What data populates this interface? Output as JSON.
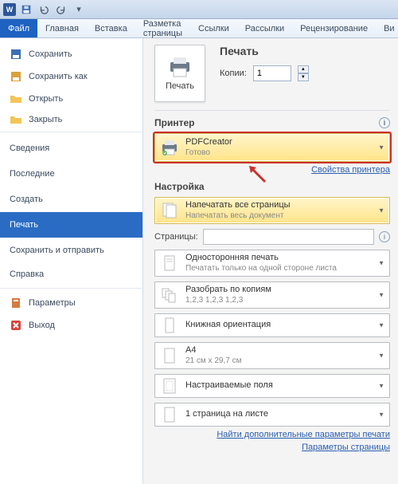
{
  "qat": {
    "app": "W"
  },
  "ribbon": {
    "tabs": [
      "Файл",
      "Главная",
      "Вставка",
      "Разметка страницы",
      "Ссылки",
      "Рассылки",
      "Рецензирование",
      "Ви"
    ],
    "active": 0
  },
  "sidebar": {
    "save": "Сохранить",
    "save_as": "Сохранить как",
    "open": "Открыть",
    "close": "Закрыть",
    "info": "Сведения",
    "recent": "Последние",
    "create": "Создать",
    "print": "Печать",
    "share": "Сохранить и отправить",
    "help": "Справка",
    "options": "Параметры",
    "exit": "Выход"
  },
  "content": {
    "print_label": "Печать",
    "print_heading": "Печать",
    "copies_label": "Копии:",
    "copies_value": "1",
    "printer_heading": "Принтер",
    "printer": {
      "name": "PDFCreator",
      "status": "Готово"
    },
    "printer_props": "Свойства принтера",
    "settings_heading": "Настройка",
    "pages_all": {
      "title": "Напечатать все страницы",
      "sub": "Напечатать весь документ"
    },
    "pages_label": "Страницы:",
    "pages_value": "",
    "duplex": {
      "title": "Односторонняя печать",
      "sub": "Печатать только на одной стороне листа"
    },
    "collate": {
      "title": "Разобрать по копиям",
      "sub": "1,2,3    1,2,3    1,2,3"
    },
    "orient": {
      "title": "Книжная ориентация"
    },
    "paper": {
      "title": "A4",
      "sub": "21 см x 29,7 см"
    },
    "margins": {
      "title": "Настраиваемые поля"
    },
    "sheets": {
      "title": "1 страница на листе"
    },
    "more_link": "Найти дополнительные параметры печати",
    "page_setup": "Параметры страницы"
  }
}
